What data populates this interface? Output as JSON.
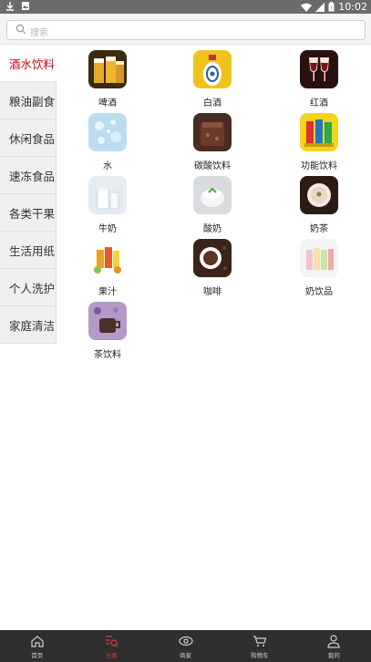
{
  "status": {
    "time": "10:02"
  },
  "search": {
    "placeholder": "搜索"
  },
  "sidebar": {
    "items": [
      {
        "label": "酒水饮料",
        "active": true
      },
      {
        "label": "粮油副食",
        "active": false
      },
      {
        "label": "休闲食品",
        "active": false
      },
      {
        "label": "速冻食品",
        "active": false
      },
      {
        "label": "各类干果",
        "active": false
      },
      {
        "label": "生活用纸",
        "active": false
      },
      {
        "label": "个人洗护",
        "active": false
      },
      {
        "label": "家庭清洁",
        "active": false
      }
    ]
  },
  "grid": {
    "items": [
      {
        "label": "啤酒",
        "icon": "beer-image"
      },
      {
        "label": "白酒",
        "icon": "baijiu-image"
      },
      {
        "label": "红酒",
        "icon": "red-wine-image"
      },
      {
        "label": "水",
        "icon": "water-image"
      },
      {
        "label": "碳酸饮料",
        "icon": "soda-image"
      },
      {
        "label": "功能饮料",
        "icon": "energy-drink-image"
      },
      {
        "label": "牛奶",
        "icon": "milk-image"
      },
      {
        "label": "酸奶",
        "icon": "yogurt-image"
      },
      {
        "label": "奶茶",
        "icon": "milk-tea-image"
      },
      {
        "label": "果汁",
        "icon": "juice-image"
      },
      {
        "label": "咖啡",
        "icon": "coffee-image"
      },
      {
        "label": "奶饮品",
        "icon": "milk-drink-image"
      },
      {
        "label": "茶饮料",
        "icon": "tea-drink-image"
      }
    ]
  },
  "nav": {
    "items": [
      {
        "label": "首页",
        "icon": "home-icon",
        "active": false
      },
      {
        "label": "分类",
        "icon": "category-icon",
        "active": true
      },
      {
        "label": "商家",
        "icon": "eye-icon",
        "active": false
      },
      {
        "label": "购物车",
        "icon": "cart-icon",
        "active": false
      },
      {
        "label": "我的",
        "icon": "user-icon",
        "active": false
      }
    ]
  },
  "colors": {
    "accent": "#d0021b",
    "nav_bg": "#2f2f2f",
    "sidebar_bg": "#efefef"
  }
}
